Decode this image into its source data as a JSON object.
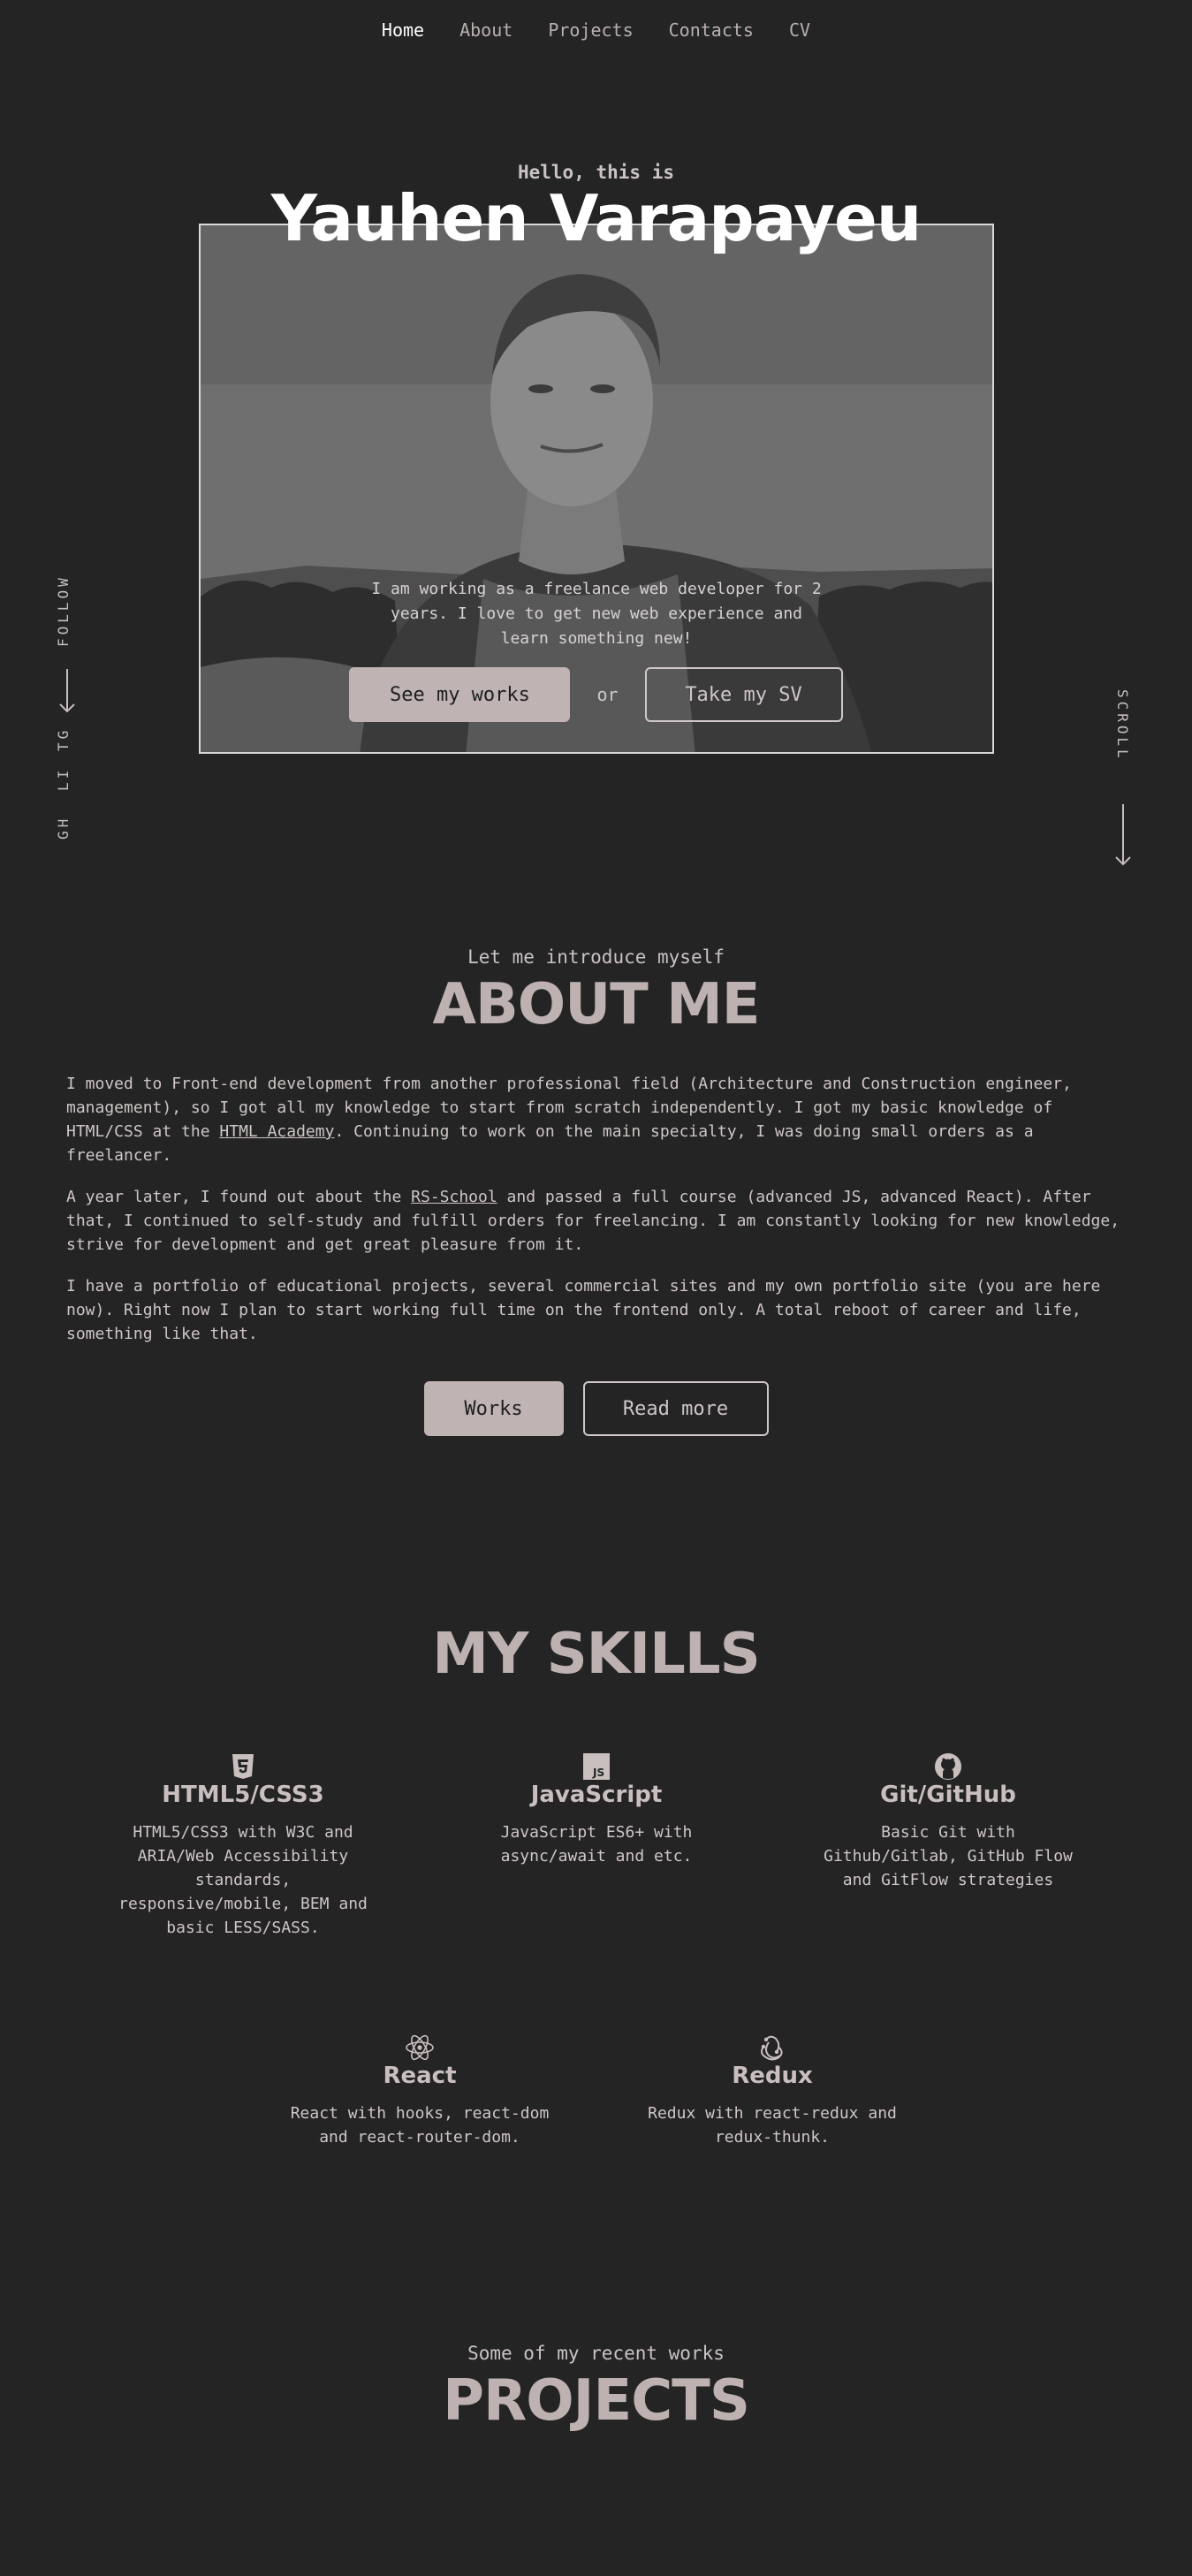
{
  "nav": {
    "items": [
      {
        "label": "Home",
        "active": true
      },
      {
        "label": "About",
        "active": false
      },
      {
        "label": "Projects",
        "active": false
      },
      {
        "label": "Contacts",
        "active": false
      },
      {
        "label": "CV",
        "active": false
      }
    ]
  },
  "hero": {
    "greeting": "Hello, this is",
    "name": "Yauhen Varapayeu",
    "text": "I am working as a freelance web developer for 2 years. I love to get new web experience and learn something new!",
    "primary_button": "See my works",
    "or": "or",
    "secondary_button": "Take my SV"
  },
  "side": {
    "follow_label": "FOLLOW",
    "links": [
      "TG",
      "LI",
      "GH"
    ],
    "scroll_label": "SCROLL"
  },
  "about": {
    "subtitle": "Let me introduce myself",
    "title": "ABOUT ME",
    "p1_before": "I moved to Front-end development from another professional field (Architecture and Construction engineer, management), so I got all my knowledge to start from scratch independently. I got my basic knowledge of HTML/CSS at the ",
    "p1_link": "HTML Academy",
    "p1_after": ". Continuing to work on the main specialty, I was doing small orders as a freelancer.",
    "p2_before": "A year later, I found out about the ",
    "p2_link": "RS-School",
    "p2_after": " and passed a full course (advanced JS, advanced React). After that, I continued to self-study and fulfill orders for freelancing. I am constantly looking for new knowledge, strive for development and get great pleasure from it.",
    "p3": "I have a portfolio of educational projects, several commercial sites and my own portfolio site (you are here now). Right now I plan to start working full time on the frontend only. A total reboot of career and life, something like that.",
    "works_button": "Works",
    "read_more_button": "Read more"
  },
  "skills": {
    "title": "MY SKILLS",
    "items": [
      {
        "icon": "html5-icon",
        "name": "HTML5/CSS3",
        "desc": "HTML5/CSS3 with W3C and ARIA/Web Accessibility standards, responsive/mobile, BEM and basic LESS/SASS."
      },
      {
        "icon": "javascript-icon",
        "name": "JavaScript",
        "desc": "JavaScript ES6+ with async/await and etc."
      },
      {
        "icon": "github-icon",
        "name": "Git/GitHub",
        "desc": "Basic Git with Github/Gitlab, GitHub Flow and GitFlow strategies"
      },
      {
        "icon": "react-icon",
        "name": "React",
        "desc": "React with hooks, react-dom and react-router-dom."
      },
      {
        "icon": "redux-icon",
        "name": "Redux",
        "desc": "Redux with react-redux and redux-thunk."
      }
    ]
  },
  "projects": {
    "subtitle": "Some of my recent works",
    "title": "PROJECTS"
  }
}
